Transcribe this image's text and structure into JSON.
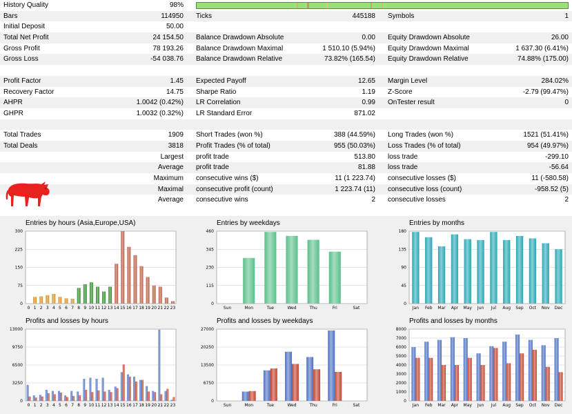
{
  "history_quality": {
    "label": "History Quality",
    "value": "98%"
  },
  "stats_rows": [
    {
      "cols": [
        {
          "label": "Bars",
          "value": "114950"
        },
        {
          "label": "Ticks",
          "value": "445188"
        },
        {
          "label": "Symbols",
          "value": "1"
        }
      ]
    },
    {
      "cols": [
        {
          "label": "Initial Deposit",
          "value": "50.00"
        },
        {
          "label": "",
          "value": ""
        },
        {
          "label": "",
          "value": ""
        }
      ]
    },
    {
      "cols": [
        {
          "label": "Total Net Profit",
          "value": "24 154.50"
        },
        {
          "label": "Balance Drawdown Absolute",
          "value": "0.00"
        },
        {
          "label": "Equity Drawdown Absolute",
          "value": "26.00"
        }
      ]
    },
    {
      "cols": [
        {
          "label": "Gross Profit",
          "value": "78 193.26"
        },
        {
          "label": "Balance Drawdown Maximal",
          "value": "1 510.10 (5.94%)"
        },
        {
          "label": "Equity Drawdown Maximal",
          "value": "1 637.30 (6.41%)"
        }
      ]
    },
    {
      "cols": [
        {
          "label": "Gross Loss",
          "value": "-54 038.76"
        },
        {
          "label": "Balance Drawdown Relative",
          "value": "73.82% (165.54)"
        },
        {
          "label": "Equity Drawdown Relative",
          "value": "74.88% (175.00)"
        }
      ]
    },
    {
      "blank": true
    },
    {
      "cols": [
        {
          "label": "Profit Factor",
          "value": "1.45"
        },
        {
          "label": "Expected Payoff",
          "value": "12.65"
        },
        {
          "label": "Margin Level",
          "value": "284.02%"
        }
      ]
    },
    {
      "cols": [
        {
          "label": "Recovery Factor",
          "value": "14.75"
        },
        {
          "label": "Sharpe Ratio",
          "value": "1.19"
        },
        {
          "label": "Z-Score",
          "value": "-2.79 (99.47%)"
        }
      ]
    },
    {
      "cols": [
        {
          "label": "AHPR",
          "value": "1.0042 (0.42%)"
        },
        {
          "label": "LR Correlation",
          "value": "0.99"
        },
        {
          "label": "OnTester result",
          "value": "0"
        }
      ]
    },
    {
      "cols": [
        {
          "label": "GHPR",
          "value": "1.0032 (0.32%)"
        },
        {
          "label": "LR Standard Error",
          "value": "871.02"
        },
        {
          "label": "",
          "value": ""
        }
      ]
    },
    {
      "blank": true
    },
    {
      "cols": [
        {
          "label": "Total Trades",
          "value": "1909"
        },
        {
          "label": "Short Trades (won %)",
          "value": "388 (44.59%)"
        },
        {
          "label": "Long Trades (won %)",
          "value": "1521 (51.41%)"
        }
      ]
    },
    {
      "cols": [
        {
          "label": "Total Deals",
          "value": "3818"
        },
        {
          "label": "Profit Trades (% of total)",
          "value": "955 (50.03%)"
        },
        {
          "label": "Loss Trades (% of total)",
          "value": "954 (49.97%)"
        }
      ]
    },
    {
      "right1": true,
      "cols": [
        {
          "label": "Largest",
          "value": ""
        },
        {
          "label": "profit trade",
          "value": "513.80"
        },
        {
          "label": "loss trade",
          "value": "-299.10"
        }
      ]
    },
    {
      "right1": true,
      "cols": [
        {
          "label": "Average",
          "value": ""
        },
        {
          "label": "profit trade",
          "value": "81.88"
        },
        {
          "label": "loss trade",
          "value": "-56.64"
        }
      ]
    },
    {
      "right1": true,
      "cols": [
        {
          "label": "Maximum",
          "value": ""
        },
        {
          "label": "consecutive wins ($)",
          "value": "11 (1 223.74)"
        },
        {
          "label": "consecutive losses ($)",
          "value": "11 (-580.58)"
        }
      ]
    },
    {
      "right1": true,
      "cols": [
        {
          "label": "Maximal",
          "value": ""
        },
        {
          "label": "consecutive profit (count)",
          "value": "1 223.74 (11)"
        },
        {
          "label": "consecutive loss (count)",
          "value": "-958.52 (5)"
        }
      ]
    },
    {
      "right1": true,
      "cols": [
        {
          "label": "Average",
          "value": ""
        },
        {
          "label": "consecutive wins",
          "value": "2"
        },
        {
          "label": "consecutive losses",
          "value": "2"
        }
      ]
    }
  ],
  "colors": {
    "bull": "#e8231f",
    "orange": "#d4901a",
    "green": "#2f8a2a",
    "brown": "#b85a40",
    "teal": "#27a7b5",
    "mint": "#5ac08a",
    "blue": "#4b6fc2",
    "red": "#c0432f"
  },
  "chart_data": [
    {
      "type": "bar",
      "title": "Entries by hours (Asia,Europe,USA)",
      "ylim": [
        0,
        300
      ],
      "yticks": [
        "300",
        "225",
        "150",
        "75",
        "0"
      ],
      "categories": [
        "0",
        "1",
        "2",
        "3",
        "4",
        "5",
        "6",
        "7",
        "8",
        "9",
        "10",
        "11",
        "12",
        "13",
        "14",
        "15",
        "16",
        "17",
        "18",
        "19",
        "20",
        "21",
        "22",
        "23"
      ],
      "values": [
        0,
        28,
        30,
        35,
        40,
        28,
        22,
        20,
        65,
        80,
        88,
        70,
        50,
        70,
        165,
        300,
        235,
        200,
        155,
        110,
        75,
        70,
        25,
        10
      ],
      "groups": [
        "orange",
        "orange",
        "orange",
        "orange",
        "orange",
        "orange",
        "orange",
        "orange",
        "green",
        "green",
        "green",
        "green",
        "green",
        "green",
        "brown",
        "brown",
        "brown",
        "brown",
        "brown",
        "brown",
        "brown",
        "brown",
        "brown",
        "brown"
      ]
    },
    {
      "type": "bar",
      "title": "Entries by weekdays",
      "ylim": [
        0,
        460
      ],
      "yticks": [
        "460",
        "345",
        "230",
        "115",
        "0"
      ],
      "categories": [
        "Sun",
        "Mon",
        "Tue",
        "Wed",
        "Thu",
        "Fri",
        "Sat"
      ],
      "values": [
        0,
        290,
        455,
        430,
        405,
        330,
        0
      ]
    },
    {
      "type": "bar",
      "title": "Entries by months",
      "ylim": [
        0,
        180
      ],
      "yticks": [
        "180",
        "135",
        "90",
        "45",
        "0"
      ],
      "categories": [
        "Jan",
        "Feb",
        "Mar",
        "Apr",
        "May",
        "Jun",
        "Jul",
        "Aug",
        "Sep",
        "Oct",
        "Nov",
        "Dec"
      ],
      "values": [
        178,
        165,
        142,
        172,
        160,
        158,
        178,
        158,
        168,
        162,
        150,
        135
      ]
    },
    {
      "type": "bar",
      "title": "Profits and losses by hours",
      "ylim": [
        0,
        13000
      ],
      "yticks": [
        "13000",
        "9750",
        "6500",
        "3250",
        "0"
      ],
      "categories": [
        "0",
        "1",
        "2",
        "3",
        "4",
        "5",
        "6",
        "7",
        "8",
        "9",
        "10",
        "11",
        "12",
        "13",
        "14",
        "15",
        "16",
        "17",
        "18",
        "19",
        "20",
        "21",
        "22",
        "23"
      ],
      "series": [
        {
          "values": [
            2900,
            1000,
            1100,
            2000,
            1800,
            1800,
            1000,
            1800,
            1700,
            4000,
            4200,
            4000,
            4200,
            2000,
            2600,
            5200,
            4800,
            4400,
            3800,
            2700,
            1800,
            12900,
            1800,
            200
          ]
        },
        {
          "values": [
            800,
            600,
            800,
            1400,
            1200,
            1500,
            700,
            900,
            1000,
            2000,
            1600,
            1900,
            1700,
            1600,
            2300,
            6600,
            4400,
            3500,
            3800,
            1700,
            1600,
            1200,
            2200,
            700
          ]
        }
      ]
    },
    {
      "type": "bar",
      "title": "Profits and losses by weekdays",
      "ylim": [
        0,
        27000
      ],
      "yticks": [
        "27000",
        "20250",
        "13500",
        "6750",
        "0"
      ],
      "categories": [
        "Sun",
        "Mon",
        "Tue",
        "Wed",
        "Thu",
        "Fri",
        "Sat"
      ],
      "series": [
        {
          "values": [
            0,
            3500,
            11500,
            18500,
            16500,
            26500,
            0
          ]
        },
        {
          "values": [
            0,
            3700,
            12200,
            13900,
            11900,
            10900,
            0
          ]
        }
      ]
    },
    {
      "type": "bar",
      "title": "Profits and losses by months",
      "ylim": [
        0,
        8000
      ],
      "yticks": [
        "8000",
        "7000",
        "6000",
        "5000",
        "4000",
        "3000",
        "2000",
        "1000",
        "0"
      ],
      "categories": [
        "Jan",
        "Feb",
        "Mar",
        "Apr",
        "May",
        "Jun",
        "Jul",
        "Aug",
        "Sep",
        "Oct",
        "Nov",
        "Dec"
      ],
      "series": [
        {
          "values": [
            6000,
            6600,
            6800,
            7100,
            7000,
            5300,
            6100,
            6600,
            7400,
            6800,
            6200,
            7000
          ]
        },
        {
          "values": [
            4800,
            4800,
            4000,
            4000,
            4800,
            4000,
            5900,
            4200,
            5300,
            5700,
            3800,
            3200
          ]
        }
      ]
    }
  ]
}
